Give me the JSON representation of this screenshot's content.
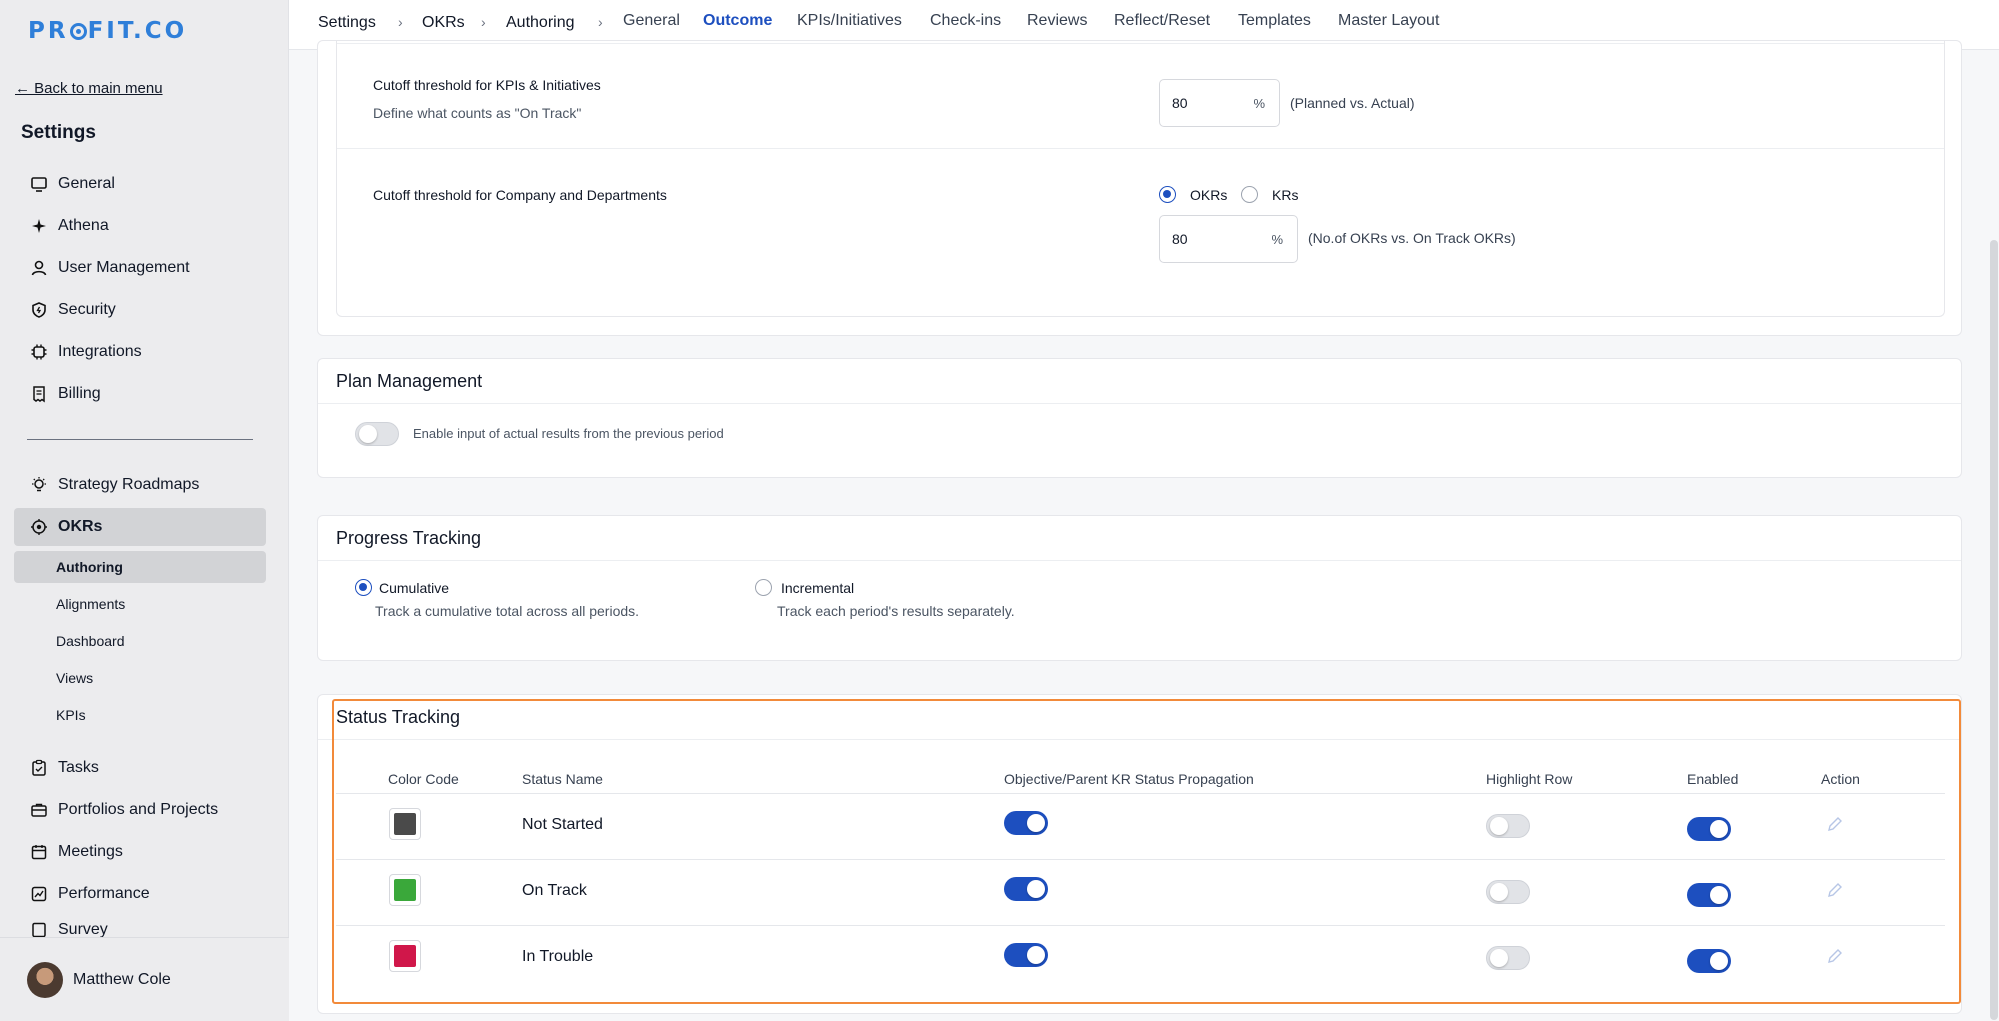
{
  "brand": {
    "logo_pre": "PR",
    "logo_post": "FIT.CO",
    "color": "#2f7fd9"
  },
  "sidebar": {
    "back_link": "← Back to main menu",
    "title": "Settings",
    "items": [
      {
        "label": "General",
        "icon": "monitor-icon"
      },
      {
        "label": "Athena",
        "icon": "sparkle-icon"
      },
      {
        "label": "User Management",
        "icon": "user-icon"
      },
      {
        "label": "Security",
        "icon": "shield-icon"
      },
      {
        "label": "Integrations",
        "icon": "chip-icon"
      },
      {
        "label": "Billing",
        "icon": "receipt-icon"
      }
    ],
    "items2": [
      {
        "label": "Strategy Roadmaps",
        "icon": "bulb-icon"
      },
      {
        "label": "OKRs",
        "icon": "target-icon"
      }
    ],
    "okr_sub": [
      "Authoring",
      "Alignments",
      "Dashboard",
      "Views",
      "KPIs"
    ],
    "items3": [
      {
        "label": "Tasks",
        "icon": "clipboard-icon"
      },
      {
        "label": "Portfolios and Projects",
        "icon": "briefcase-icon"
      },
      {
        "label": "Meetings",
        "icon": "calendar-icon"
      },
      {
        "label": "Performance",
        "icon": "chart-icon"
      },
      {
        "label": "Survey",
        "icon": "survey-icon"
      }
    ],
    "user": {
      "name": "Matthew Cole"
    }
  },
  "topbar": {
    "breadcrumb": [
      "Settings",
      "OKRs",
      "Authoring"
    ],
    "tabs": [
      "General",
      "Outcome",
      "KPIs/Initiatives",
      "Check-ins",
      "Reviews",
      "Reflect/Reset",
      "Templates",
      "Master Layout"
    ],
    "active_tab": "Outcome"
  },
  "cutoff_kpi": {
    "label": "Cutoff threshold for KPIs & Initiatives",
    "desc": "Define what counts as \"On Track\"",
    "value": "80",
    "unit": "%",
    "suffix": "(Planned vs. Actual)"
  },
  "cutoff_company": {
    "label": "Cutoff threshold for Company and Departments",
    "option_okrs": "OKRs",
    "option_krs": "KRs",
    "selected": "OKRs",
    "value": "80",
    "unit": "%",
    "suffix": "(No.of OKRs vs. On Track OKRs)"
  },
  "plan_management": {
    "title": "Plan Management",
    "toggle_label": "Enable input of actual results from the previous period",
    "enabled": false
  },
  "progress_tracking": {
    "title": "Progress Tracking",
    "cumulative": {
      "label": "Cumulative",
      "desc": "Track a cumulative total across all periods."
    },
    "incremental": {
      "label": "Incremental",
      "desc": "Track each period's results separately."
    },
    "selected": "Cumulative"
  },
  "status_tracking": {
    "title": "Status Tracking",
    "columns": [
      "Color Code",
      "Status Name",
      "Objective/Parent KR Status Propagation",
      "Highlight Row",
      "Enabled",
      "Action"
    ],
    "rows": [
      {
        "name": "Not Started",
        "color": "#4a4a4a",
        "propagation": true,
        "highlight": false,
        "enabled": true
      },
      {
        "name": "On Track",
        "color": "#3aa83a",
        "propagation": true,
        "highlight": false,
        "enabled": true
      },
      {
        "name": "In Trouble",
        "color": "#d0174a",
        "propagation": true,
        "highlight": false,
        "enabled": true
      }
    ]
  },
  "colors": {
    "accent": "#1d4fbf",
    "highlight_border": "#f28a3a"
  }
}
